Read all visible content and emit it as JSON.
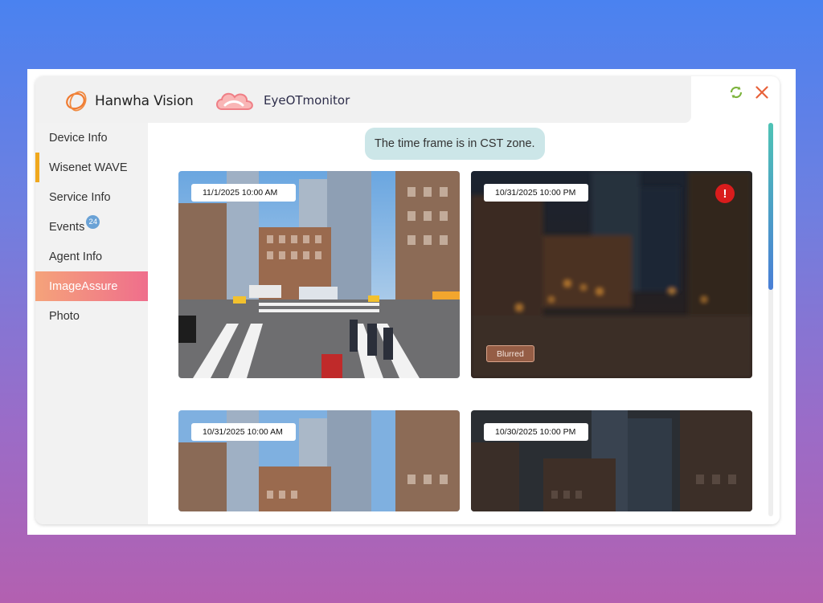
{
  "brand": {
    "primary": "Hanwha Vision",
    "secondary": "EyeOTmonitor"
  },
  "header_actions": {
    "refresh_icon": "refresh-icon",
    "close_icon": "close-icon"
  },
  "sidebar": {
    "items": [
      {
        "label": "Device Info"
      },
      {
        "label": "Wisenet WAVE"
      },
      {
        "label": "Service Info"
      },
      {
        "label": "Events",
        "badge": "24"
      },
      {
        "label": "Agent Info"
      },
      {
        "label": "ImageAssure"
      },
      {
        "label": "Photo"
      }
    ]
  },
  "main": {
    "timezone_notice": "The time frame is in CST zone.",
    "snapshots": [
      {
        "timestamp": "11/1/2025 10:00 AM",
        "status": "clear"
      },
      {
        "timestamp": "10/31/2025 10:00 PM",
        "status": "blurred",
        "tag": "Blurred",
        "alert": "!"
      },
      {
        "timestamp": "10/31/2025 10:00 AM",
        "status": "clear"
      },
      {
        "timestamp": "10/30/2025 10:00 PM",
        "status": "dark"
      }
    ]
  },
  "colors": {
    "accent_active": "#f0a81e",
    "selected_start": "#f5a37a",
    "selected_end": "#ef6e8c",
    "alert": "#d91c1c"
  }
}
